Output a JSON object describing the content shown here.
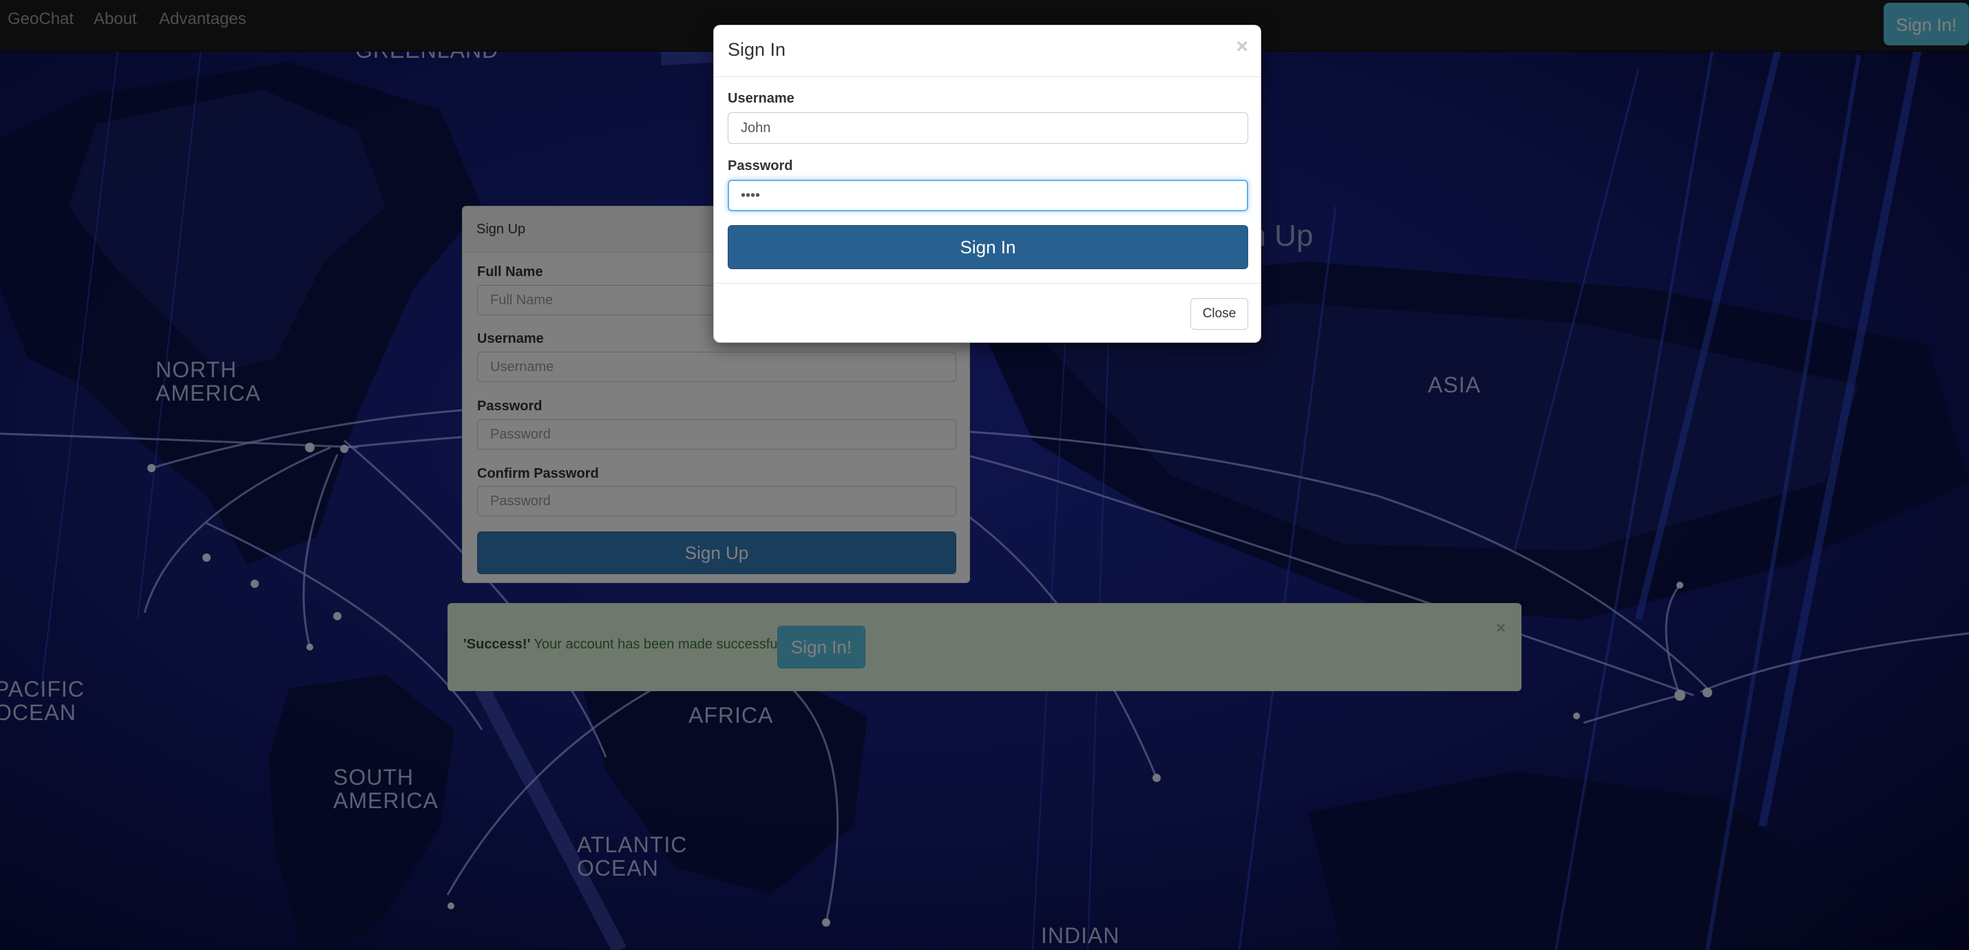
{
  "navbar": {
    "brand": "GeoChat",
    "links": [
      "About",
      "Advantages"
    ],
    "signin_label": "Sign In!"
  },
  "map_labels": {
    "greenland": "GREENLAND",
    "north_america": "NORTH AMERICA",
    "asia": "ASIA",
    "pacific_ocean": "PACIFIC OCEAN",
    "africa": "AFRICA",
    "south_america": "SOUTH AMERICA",
    "atlantic_ocean": "ATLANTIC OCEAN",
    "indian": "INDIAN"
  },
  "background_heading_fragment": "gn Up",
  "signup": {
    "title": "Sign Up",
    "fields": [
      {
        "label": "Full Name",
        "placeholder": "Full Name"
      },
      {
        "label": "Username",
        "placeholder": "Username"
      },
      {
        "label": "Password",
        "placeholder": "Password"
      },
      {
        "label": "Confirm Password",
        "placeholder": "Password"
      }
    ],
    "button_label": "Sign Up"
  },
  "alert": {
    "strong": "'Success!'",
    "message": " Your account has been made successfully.",
    "button_label": "Sign In!",
    "close": "×"
  },
  "modal": {
    "title": "Sign In",
    "close_x": "×",
    "username_label": "Username",
    "username_value": "John",
    "password_label": "Password",
    "password_value": "••••",
    "submit_label": "Sign In",
    "close_label": "Close"
  },
  "colors": {
    "navbar": "#1b1b1b",
    "primary": "#337ab7",
    "info": "#5bc0de",
    "success_bg": "#dff0d8"
  }
}
